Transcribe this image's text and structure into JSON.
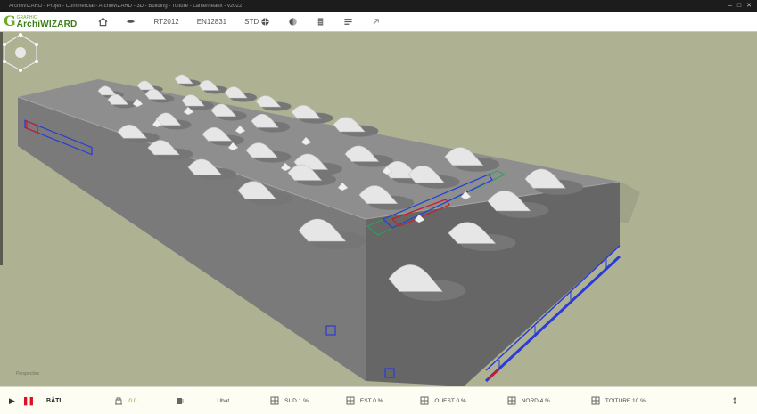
{
  "window": {
    "title": "ArchiWIZARD - Projet - Commercial - ArchiWIZARD - 3D - Building - Toiture - Lanterneaux - v2022"
  },
  "app": {
    "logo_small": "GRAPHIC",
    "logo_name": "ArchiWIZARD"
  },
  "toolbar": {
    "items": [
      {
        "label": ""
      },
      {
        "label": ""
      },
      {
        "label": "RT2012"
      },
      {
        "label": "EN12831"
      },
      {
        "label": "STD"
      },
      {
        "label": ""
      },
      {
        "label": ""
      },
      {
        "label": ""
      },
      {
        "label": ""
      }
    ]
  },
  "viewport": {
    "label": "Perspective"
  },
  "statusbar": {
    "bati": "BÂTI",
    "level": "0.0",
    "ubat": "Ubat",
    "sud": "SUD 1 %",
    "est": "EST 0 %",
    "ouest": "OUEST 0 %",
    "nord": "NORD 4 %",
    "toiture": "TOITURE 10 %"
  },
  "colors": {
    "background": "#aeb292",
    "roof": "#8d8d8d",
    "side_front": "#6f6f6f",
    "side_left": "#7c7c7c",
    "shadow_ground": "#9a9d83",
    "skylight": "#e6e6e6",
    "window_blue": "#2a3bd8",
    "window_red": "#d01a2a",
    "selection_green": "#2aa35a",
    "accent_green": "#6fa82a"
  }
}
